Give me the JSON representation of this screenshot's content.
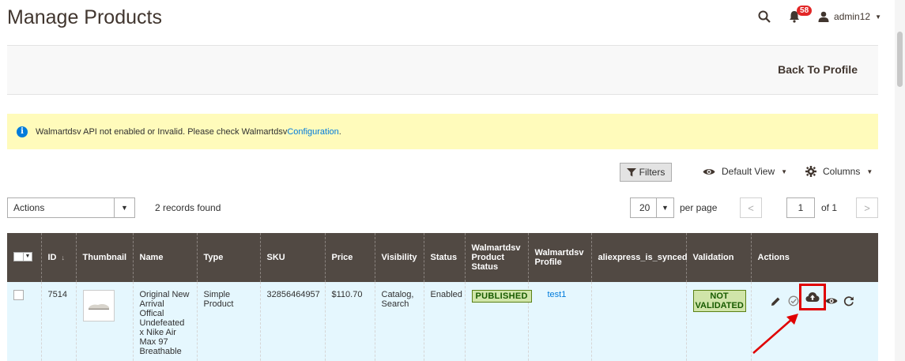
{
  "page": {
    "title": "Manage Products"
  },
  "header": {
    "notification_count": "58",
    "user": "admin12"
  },
  "action_bar": {
    "back_label": "Back To Profile"
  },
  "message": {
    "text": "Walmartdsv API not enabled or Invalid. Please check Walmartdsv ",
    "link": "Configuration",
    "suffix": "."
  },
  "toolbar": {
    "filters_label": "Filters",
    "view_label": "Default View",
    "columns_label": "Columns",
    "actions_select": "Actions",
    "records_found": "2 records found",
    "per_page_value": "20",
    "per_page_label": "per page",
    "page_value": "1",
    "page_of": "of 1"
  },
  "grid": {
    "columns": [
      "ID",
      "Thumbnail",
      "Name",
      "Type",
      "SKU",
      "Price",
      "Visibility",
      "Status",
      "Walmartdsv Product Status",
      "Walmartdsv Profile",
      "aliexpress_is_synced",
      "Validation",
      "Actions"
    ],
    "rows": [
      {
        "id": "7514",
        "name": "Original New Arrival Offical Undefeated x Nike Air Max 97 Breathable",
        "type": "Simple Product",
        "sku": "32856464957",
        "price": "$110.70",
        "visibility": "Catalog, Search",
        "status": "Enabled",
        "product_status": "PUBLISHED",
        "profile": "test1",
        "synced": "",
        "validation": "NOT VALIDATED"
      }
    ]
  },
  "icons": {
    "search": "search-icon",
    "bell": "bell-icon",
    "user": "user-icon",
    "info": "info-icon",
    "filter": "funnel-icon",
    "eye": "eye-icon",
    "gear": "gear-icon",
    "edit": "pencil-icon",
    "validate": "check-circle-icon",
    "upload": "cloud-upload-icon",
    "view": "eye-icon",
    "sync": "refresh-icon"
  },
  "colors": {
    "grid_header": "#514943",
    "row_bg": "#e5f7fe",
    "message_bg": "#fffbbb",
    "link": "#007bdb",
    "highlight": "#e00000",
    "badge_bg": "#d0e5a9",
    "badge_text": "#185b00"
  }
}
